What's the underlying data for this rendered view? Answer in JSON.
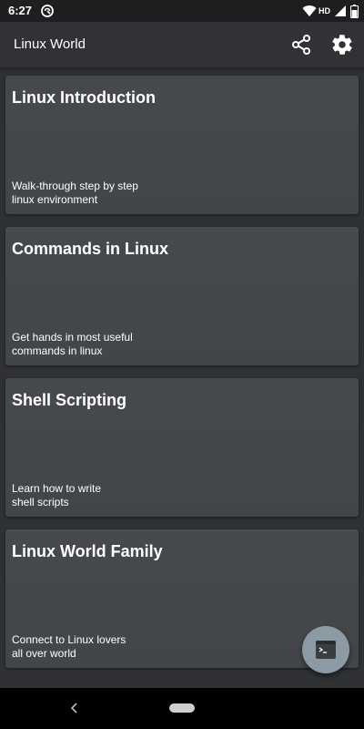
{
  "status_bar": {
    "time": "6:27",
    "network": "HD",
    "icons": [
      "notification-icon",
      "wifi-icon",
      "signal-icon",
      "battery-icon"
    ]
  },
  "app_bar": {
    "title": "Linux World",
    "actions": [
      "share-icon",
      "settings-icon"
    ]
  },
  "cards": [
    {
      "title": "Linux Introduction",
      "description": "Walk-through step by step\nlinux environment"
    },
    {
      "title": "Commands in Linux",
      "description": "Get hands in most useful\ncommands in linux"
    },
    {
      "title": "Shell Scripting",
      "description": "Learn how to write\nshell scripts"
    },
    {
      "title": "Linux World Family",
      "description": "Connect to Linux lovers\nall over world"
    }
  ],
  "fab": {
    "icon": "terminal-icon"
  },
  "nav_bar": {
    "icons": [
      "back-icon",
      "home-pill"
    ]
  },
  "colors": {
    "background": "#2f3134",
    "card": "#46494d",
    "fab": "#8c9ba3",
    "text": "#ffffff"
  }
}
